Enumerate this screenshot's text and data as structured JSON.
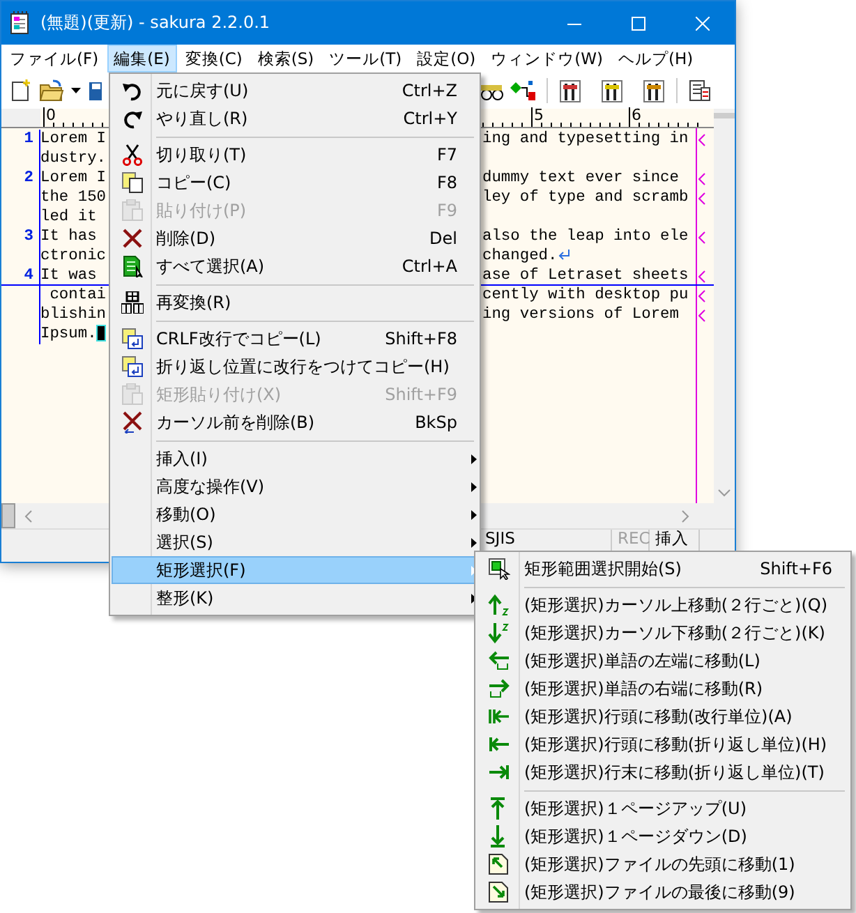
{
  "window": {
    "title": "(無題)(更新) - sakura 2.2.0.1"
  },
  "menu_bar": [
    {
      "label": "ファイル(F)",
      "selected": false
    },
    {
      "label": "編集(E)",
      "selected": true
    },
    {
      "label": "変換(C)",
      "selected": false
    },
    {
      "label": "検索(S)",
      "selected": false
    },
    {
      "label": "ツール(T)",
      "selected": false
    },
    {
      "label": "設定(O)",
      "selected": false
    },
    {
      "label": "ウィンドウ(W)",
      "selected": false
    },
    {
      "label": "ヘルプ(H)",
      "selected": false
    }
  ],
  "ruler": [
    "0",
    "5",
    "6"
  ],
  "editor": {
    "rows": [
      {
        "kind": "wrap",
        "number": "1",
        "left": "Lorem I",
        "right": "ing and typesetting in",
        "cursor": false
      },
      {
        "kind": "plain",
        "left": "dustry.",
        "cursor": false
      },
      {
        "kind": "wrap",
        "number": "2",
        "left": "Lorem I",
        "right": "dummy text ever since",
        "cursor": false
      },
      {
        "kind": "wrap",
        "left": "the 150",
        "right": "ley of type and scramb",
        "cursor": false
      },
      {
        "kind": "plain",
        "left": "led it",
        "cursor": false
      },
      {
        "kind": "wrap",
        "number": "3",
        "left": "It has",
        "right": "also the leap into ele",
        "cursor": false
      },
      {
        "kind": "newline",
        "left": "ctronic",
        "right": "changed.",
        "cursor": false
      },
      {
        "kind": "wrap",
        "number": "4",
        "left": "It was",
        "right": "ase of Letraset sheets",
        "cursor": true
      },
      {
        "kind": "wrap",
        "left": " contai",
        "right": "cently with desktop pu",
        "cursor": false
      },
      {
        "kind": "wrap",
        "left": "blishin",
        "right": "ing versions of Lorem",
        "cursor": false
      },
      {
        "kind": "eof",
        "left": "Ipsum.",
        "cursor": false
      }
    ]
  },
  "status_bar": [
    {
      "text": "SJIS",
      "disabled": false
    },
    {
      "text": "REC",
      "disabled": true
    },
    {
      "text": "挿入",
      "disabled": false
    }
  ],
  "edit_menu": {
    "items": [
      {
        "kind": "item",
        "label": "元に戻す(U)",
        "shortcut": "Ctrl+Z",
        "disabled": false,
        "selected": false
      },
      {
        "kind": "item",
        "label": "やり直し(R)",
        "shortcut": "Ctrl+Y",
        "disabled": false,
        "selected": false
      },
      {
        "kind": "separator"
      },
      {
        "kind": "item",
        "label": "切り取り(T)",
        "shortcut": "F7",
        "disabled": false,
        "selected": false
      },
      {
        "kind": "item",
        "label": "コピー(C)",
        "shortcut": "F8",
        "disabled": false,
        "selected": false
      },
      {
        "kind": "item",
        "label": "貼り付け(P)",
        "shortcut": "F9",
        "disabled": true,
        "selected": false
      },
      {
        "kind": "item",
        "label": "削除(D)",
        "shortcut": "Del",
        "disabled": false,
        "selected": false
      },
      {
        "kind": "item",
        "label": "すべて選択(A)",
        "shortcut": "Ctrl+A",
        "disabled": false,
        "selected": false
      },
      {
        "kind": "separator"
      },
      {
        "kind": "item",
        "label": "再変換(R)",
        "disabled": false,
        "selected": false
      },
      {
        "kind": "separator"
      },
      {
        "kind": "item",
        "label": "CRLF改行でコピー(L)",
        "shortcut": "Shift+F8",
        "disabled": false,
        "selected": false
      },
      {
        "kind": "item",
        "label": "折り返し位置に改行をつけてコピー(H)",
        "disabled": false,
        "selected": false
      },
      {
        "kind": "item",
        "label": "矩形貼り付け(X)",
        "shortcut": "Shift+F9",
        "disabled": true,
        "selected": false
      },
      {
        "kind": "item",
        "label": "カーソル前を削除(B)",
        "shortcut": "BkSp",
        "disabled": false,
        "selected": false
      },
      {
        "kind": "separator"
      },
      {
        "kind": "submenu",
        "label": "挿入(I)",
        "disabled": false,
        "selected": false
      },
      {
        "kind": "submenu",
        "label": "高度な操作(V)",
        "disabled": false,
        "selected": false
      },
      {
        "kind": "submenu",
        "label": "移動(O)",
        "disabled": false,
        "selected": false
      },
      {
        "kind": "submenu",
        "label": "選択(S)",
        "disabled": false,
        "selected": false
      },
      {
        "kind": "submenu",
        "label": "矩形選択(F)",
        "disabled": false,
        "selected": true
      },
      {
        "kind": "submenu",
        "label": "整形(K)",
        "disabled": false,
        "selected": false
      }
    ]
  },
  "submenu": {
    "items": [
      {
        "kind": "item",
        "label": "矩形範囲選択開始(S)",
        "shortcut": "Shift+F6",
        "disabled": false,
        "selected": false
      },
      {
        "kind": "separator"
      },
      {
        "kind": "item",
        "label": "(矩形選択)カーソル上移動(２行ごと)(Q)",
        "disabled": false,
        "selected": false
      },
      {
        "kind": "item",
        "label": "(矩形選択)カーソル下移動(２行ごと)(K)",
        "disabled": false,
        "selected": false
      },
      {
        "kind": "item",
        "label": "(矩形選択)単語の左端に移動(L)",
        "disabled": false,
        "selected": false
      },
      {
        "kind": "item",
        "label": "(矩形選択)単語の右端に移動(R)",
        "disabled": false,
        "selected": false
      },
      {
        "kind": "item",
        "label": "(矩形選択)行頭に移動(改行単位)(A)",
        "disabled": false,
        "selected": false
      },
      {
        "kind": "item",
        "label": "(矩形選択)行頭に移動(折り返し単位)(H)",
        "disabled": false,
        "selected": false
      },
      {
        "kind": "item",
        "label": "(矩形選択)行末に移動(折り返し単位)(T)",
        "disabled": false,
        "selected": false
      },
      {
        "kind": "separator"
      },
      {
        "kind": "item",
        "label": "(矩形選択)１ページアップ(U)",
        "disabled": false,
        "selected": false
      },
      {
        "kind": "item",
        "label": "(矩形選択)１ページダウン(D)",
        "disabled": false,
        "selected": false
      },
      {
        "kind": "item",
        "label": "(矩形選択)ファイルの先頭に移動(1)",
        "disabled": false,
        "selected": false
      },
      {
        "kind": "item",
        "label": "(矩形選択)ファイルの最後に移動(9)",
        "disabled": false,
        "selected": false
      }
    ]
  }
}
